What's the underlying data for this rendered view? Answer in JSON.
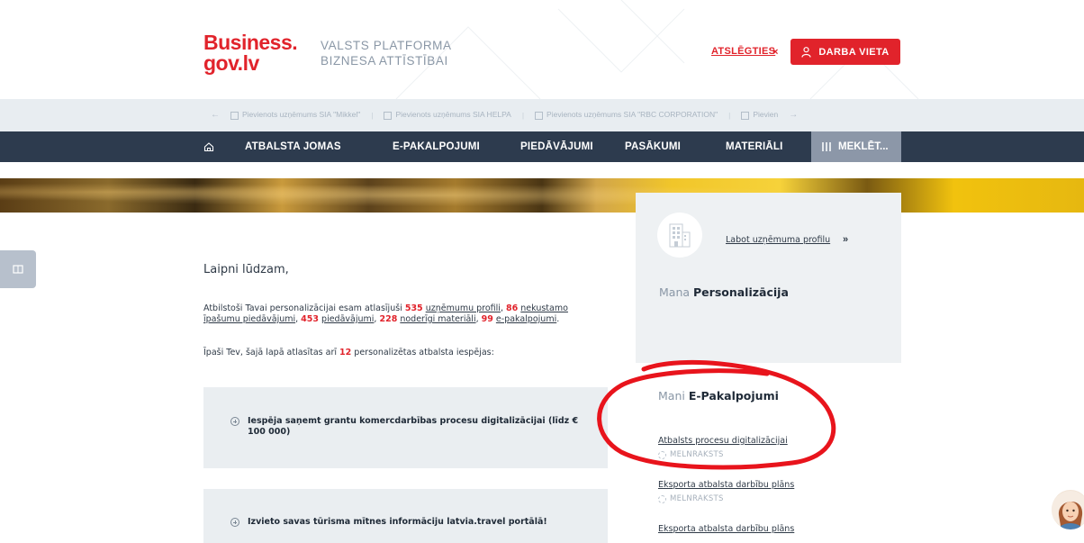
{
  "header": {
    "logo_line1": "Business.",
    "logo_line2": "gov.lv",
    "tagline_line1": "VALSTS PLATFORMA",
    "tagline_line2": "BIZNESA ATTĪSTĪBAI",
    "logout_label": "ATSLĒGTIES",
    "logout_x": "×",
    "workplace_label": "DARBA VIETA"
  },
  "ticker": {
    "items": [
      "Pievienots uzņēmums SIA \"Mikkel\"",
      "Pievienots uzņēmums SIA HELPA",
      "Pievienots uzņēmums SIA \"RBC CORPORATION\"",
      "Pievien"
    ]
  },
  "nav": {
    "items": [
      "ATBALSTA JOMAS",
      "E-PAKALPOJUMI",
      "PIEDĀVĀJUMI",
      "PASĀKUMI",
      "MATERIĀLI"
    ],
    "search_label": "MEKLĒT..."
  },
  "main": {
    "welcome": "Laipni lūdzam,",
    "intro": {
      "prefix": "Atbilstoši Tavai personalizācijai esam atlasījuši ",
      "n1": "535",
      "l1": "uzņēmumu profili",
      "n2": "86",
      "l2": "nekustamo īpašumu piedāvājumi",
      "n3": "453",
      "l3": "piedāvājumi",
      "n4": "228",
      "l4": "noderīgi materiāli",
      "n5": "99",
      "l5": "e-pakalpojumi"
    },
    "special_prefix": "Īpaši Tev, šajā lapā atlasītas arī ",
    "special_count": "12",
    "special_suffix": " personalizētas atbalsta iespējas:",
    "cards": [
      {
        "title": "Iespēja saņemt grantu komercdarbības procesu digitalizācijai (līdz € 100 000)"
      },
      {
        "title": "Izvieto savas tūrisma mītnes informāciju latvia.travel portālā!"
      }
    ]
  },
  "sidebar": {
    "edit_profile": "Labot uzņēmuma profilu",
    "edit_arrow": "»",
    "perso_muted": "Mana ",
    "perso_bold": "Personalizācija",
    "eserv_muted": "Mani ",
    "eserv_bold": "E-Pakalpojumi",
    "eservices": [
      {
        "title": "Atbalsts procesu digitalizācijai",
        "status": "MELNRAKSTS"
      },
      {
        "title": "Eksporta atbalsta darbību plāns",
        "status": "MELNRAKSTS"
      },
      {
        "title": "Eksporta atbalsta darbību plāns",
        "status": ""
      }
    ]
  },
  "colors": {
    "brand_red": "#e1232b",
    "nav_bg": "#2d3b4e",
    "panel_bg": "#eef1f3",
    "annotation": "#e8141c"
  },
  "icons": [
    "person-icon",
    "home-icon",
    "grid-icon",
    "building-icon",
    "plus-circle-icon",
    "draft-icon",
    "avatar"
  ]
}
